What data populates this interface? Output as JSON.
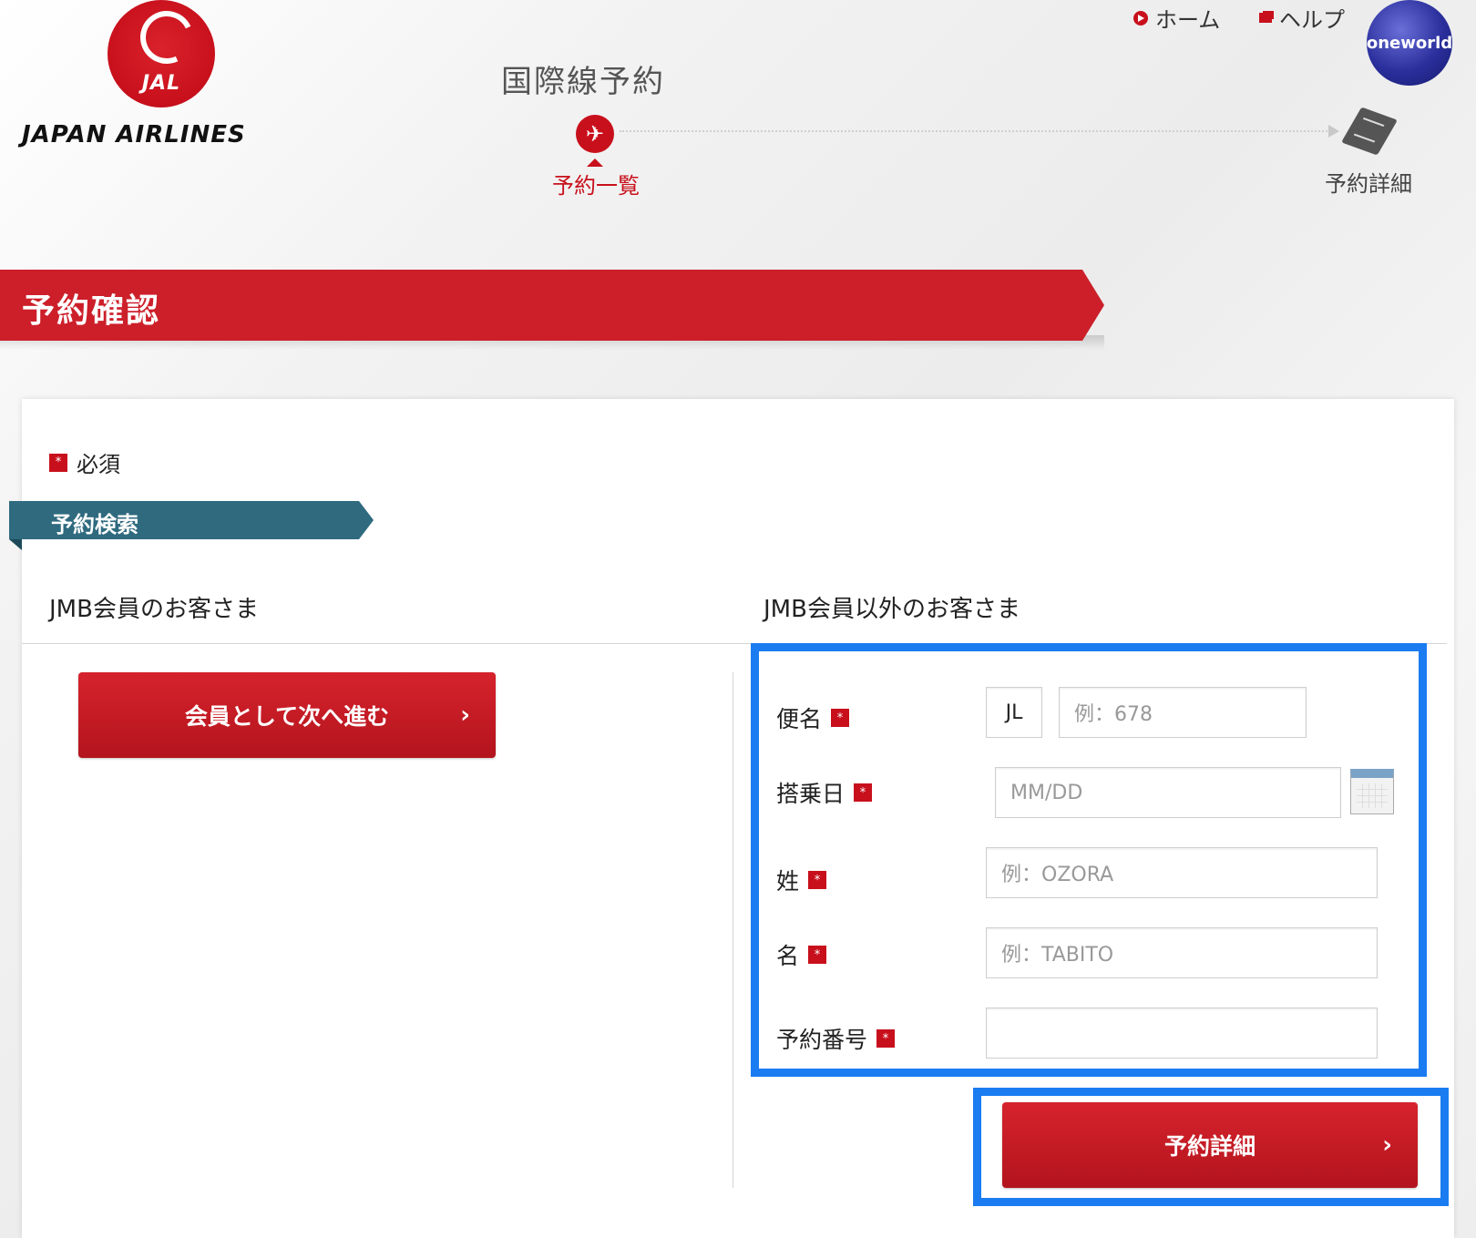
{
  "header": {
    "logo_badge_text": "JAL",
    "logo_text": "JAPAN AIRLINES",
    "page_heading": "国際線予約",
    "nav": {
      "home": "ホーム",
      "help": "ヘルプ"
    },
    "alliance_logo": "oneworld"
  },
  "steps": [
    {
      "label": "予約一覧",
      "icon": "airplane-icon",
      "active": true
    },
    {
      "label": "予約詳細",
      "icon": "ticket-icon",
      "active": false
    }
  ],
  "banner": {
    "title": "予約確認"
  },
  "form": {
    "required_legend": "必須",
    "required_mark": "*",
    "section_tab": "予約検索",
    "member_column": {
      "heading": "JMB会員のお客さま",
      "button_label": "会員として次へ進む",
      "button_chevron": "›"
    },
    "nonmember_column": {
      "heading": "JMB会員以外のお客さま",
      "flight": {
        "label": "便名",
        "prefix": "JL",
        "placeholder": "例：678"
      },
      "date": {
        "label": "搭乗日",
        "placeholder": "MM/DD"
      },
      "last_name": {
        "label": "姓",
        "placeholder": "例：OZORA"
      },
      "first_name": {
        "label": "名",
        "placeholder": "例：TABITO"
      },
      "booking_ref": {
        "label": "予約番号",
        "placeholder": ""
      },
      "submit_label": "予約詳細",
      "submit_chevron": "›"
    }
  },
  "colors": {
    "brand_red": "#c8101c",
    "teal": "#2f6a7f",
    "highlight": "#1a7cf0"
  }
}
